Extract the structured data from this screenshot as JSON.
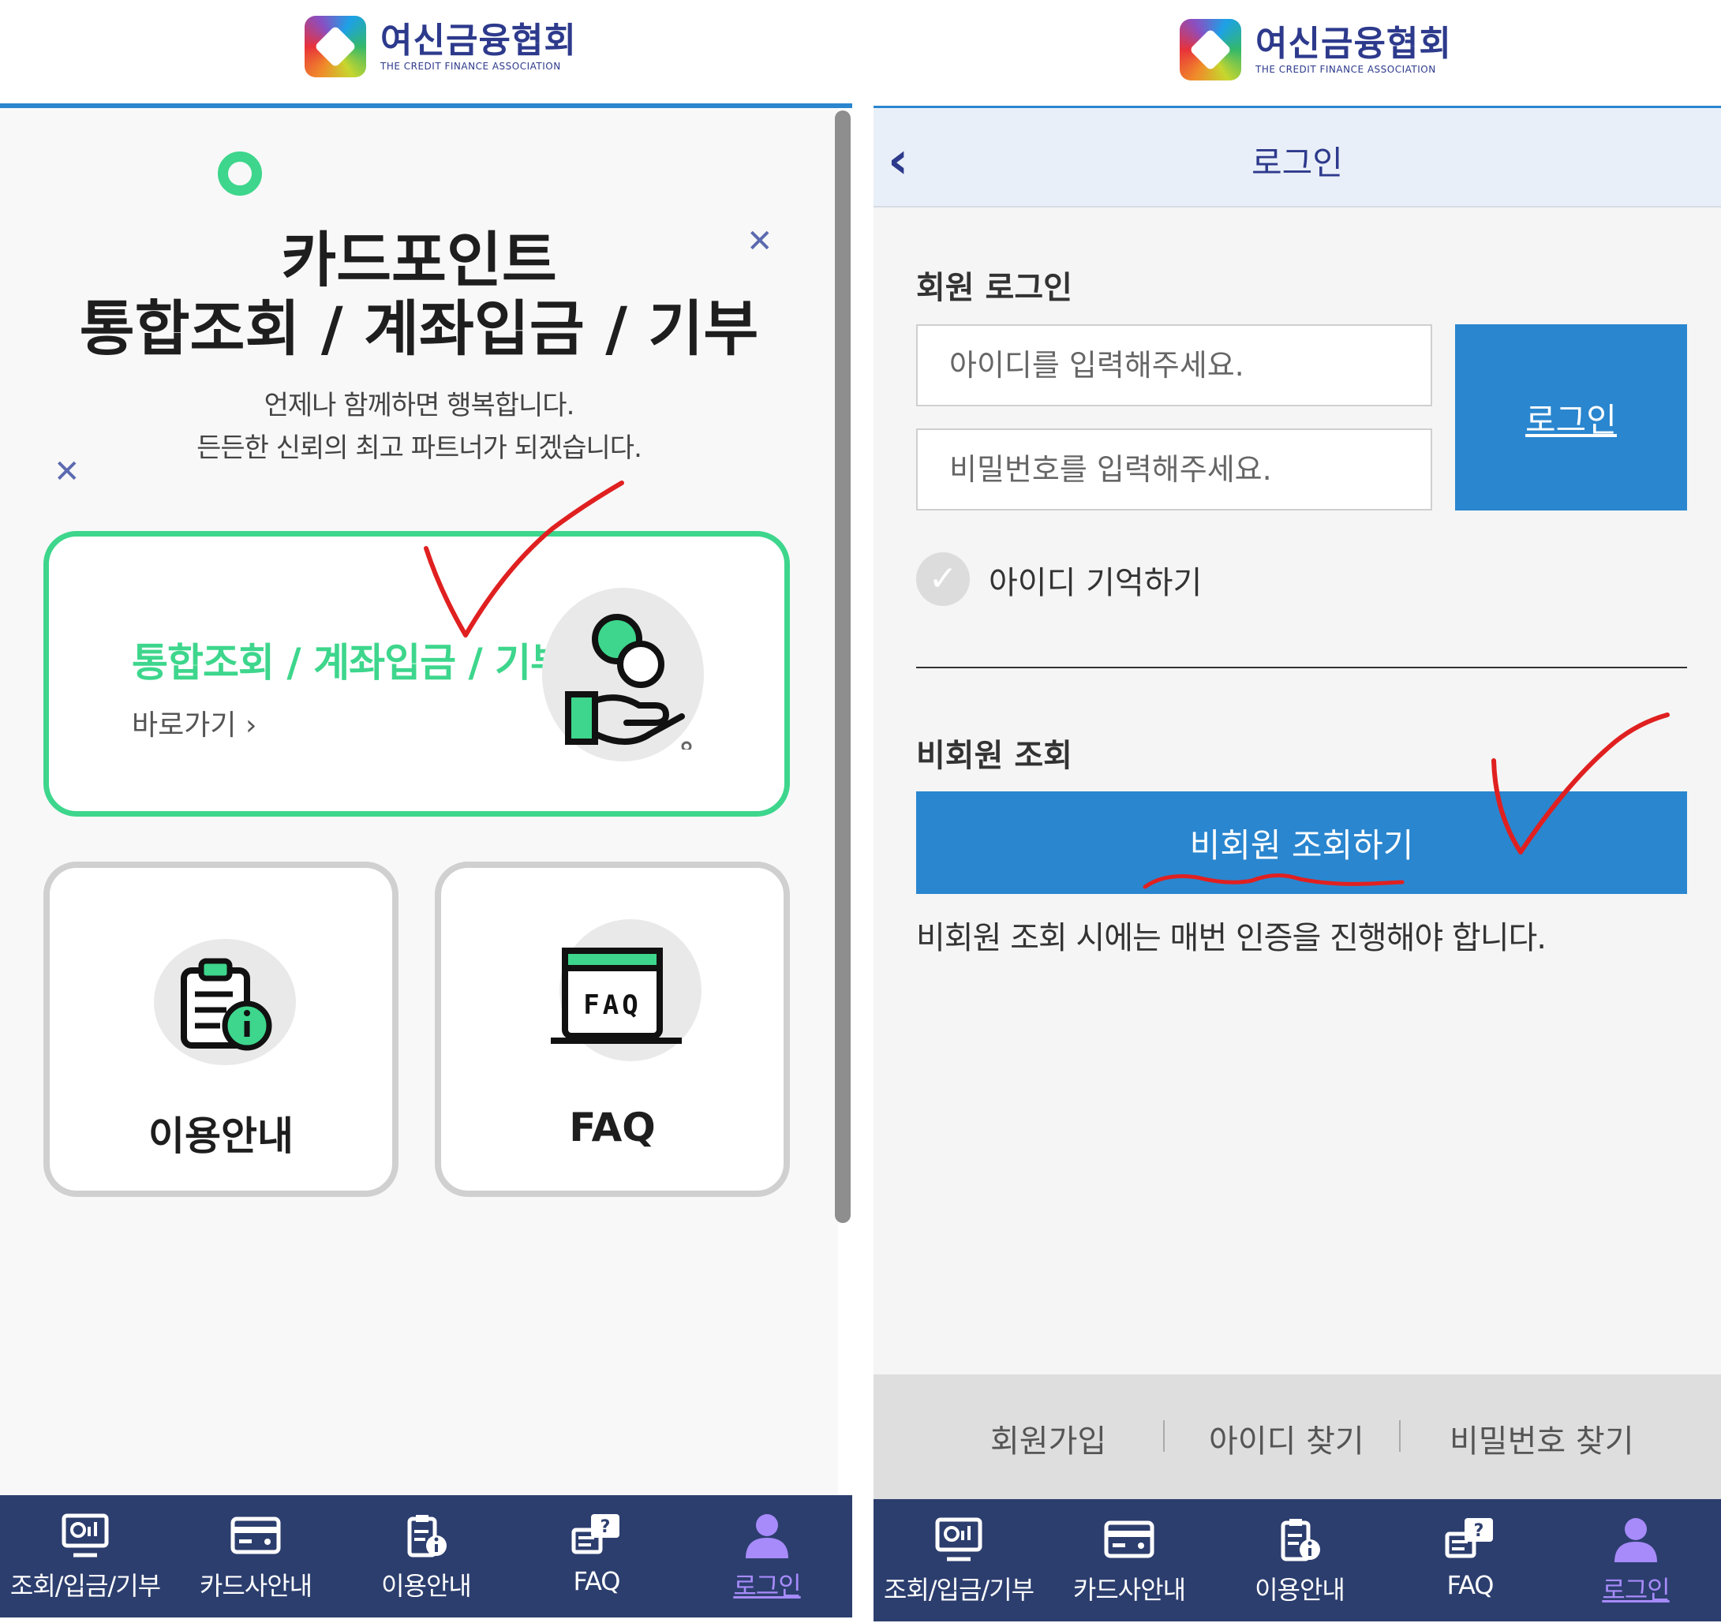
{
  "colors": {
    "brand_blue": "#2a86cf",
    "navy": "#2c3e6e",
    "green": "#3dd68c",
    "nav_active": "#a78bfa",
    "annotation_red": "#e02020"
  },
  "header": {
    "logo_ko": "여신금융협회",
    "logo_en": "THE CREDIT FINANCE ASSOCIATION"
  },
  "left": {
    "hero_title_line1": "카드포인트",
    "hero_title_line2": "통합조회 / 계좌입금 / 기부",
    "hero_sub_line1": "언제나 함께하면 행복합니다.",
    "hero_sub_line2": "든든한 신뢰의 최고 파트너가 되겠습니다.",
    "main_card": {
      "title": "통합조회 / 계좌입금 / 기부",
      "link": "바로가기",
      "icon": "coin-hand-icon"
    },
    "card_guide": {
      "label": "이용안내",
      "icon": "clipboard-info-icon"
    },
    "card_faq": {
      "label": "FAQ",
      "icon": "faq-board-icon",
      "icon_text": "FAQ"
    }
  },
  "right": {
    "page_title": "로그인",
    "member_section": "회원 로그인",
    "id_placeholder": "아이디를 입력해주세요.",
    "pw_placeholder": "비밀번호를 입력해주세요.",
    "login_button": "로그인",
    "remember_id": "아이디 기억하기",
    "guest_section": "비회원 조회",
    "guest_button": "비회원 조회하기",
    "guest_note": "비회원 조회 시에는 매번 인증을 진행해야 합니다.",
    "links": [
      "회원가입",
      "아이디 찾기",
      "비밀번호 찾기"
    ]
  },
  "nav": {
    "items": [
      {
        "label": "조회/입금/기부",
        "icon": "monitor-chart-icon"
      },
      {
        "label": "카드사안내",
        "icon": "credit-card-icon"
      },
      {
        "label": "이용안내",
        "icon": "clipboard-info-icon"
      },
      {
        "label": "FAQ",
        "icon": "question-board-icon"
      },
      {
        "label": "로그인",
        "icon": "user-icon",
        "active": true
      }
    ]
  }
}
